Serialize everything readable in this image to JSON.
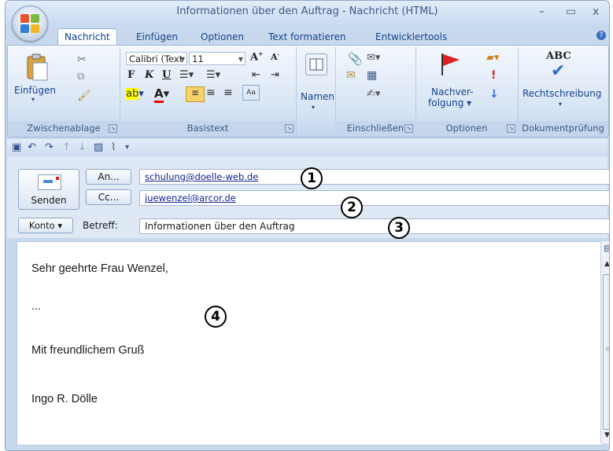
{
  "window": {
    "title": "Informationen über den Auftrag - Nachricht (HTML)",
    "minimize": "–",
    "maximize": "▭",
    "close": "x"
  },
  "tabs": [
    "Nachricht",
    "Einfügen",
    "Optionen",
    "Text formatieren",
    "Entwicklertools"
  ],
  "ribbon": {
    "clipboard": {
      "paste_label": "Einfügen",
      "group_label": "Zwischenablage"
    },
    "basictext": {
      "font": "Calibri (Text",
      "size": "11",
      "bold": "F",
      "italic": "K",
      "underline": "U",
      "group_label": "Basistext"
    },
    "names": {
      "label": "Namen"
    },
    "include": {
      "group_label": "Einschließen"
    },
    "options": {
      "followup_line1": "Nachver-",
      "followup_line2": "folgung ▾",
      "group_label": "Optionen"
    },
    "proofing": {
      "logo": "ABC",
      "label": "Rechtschreibung",
      "group_label": "Dokumentprüfung"
    }
  },
  "form": {
    "send_label": "Senden",
    "to_label": "An...",
    "cc_label": "Cc...",
    "account_label": "Konto ▾",
    "subject_label": "Betreff:",
    "to_value": "schulung@doelle-web.de",
    "cc_value": "juewenzel@arcor.de",
    "subject_value": "Informationen über den Auftrag"
  },
  "body": {
    "greeting": "Sehr geehrte Frau Wenzel,",
    "ellipsis": "...",
    "closing": "Mit freundlichem Gruß",
    "signature": "Ingo R. Dölle"
  },
  "callouts": [
    "1",
    "2",
    "3",
    "4"
  ],
  "colors": {
    "accent": "#15428b",
    "ribbon_bg": "#d7e4f4",
    "link": "#0b1f8c"
  }
}
